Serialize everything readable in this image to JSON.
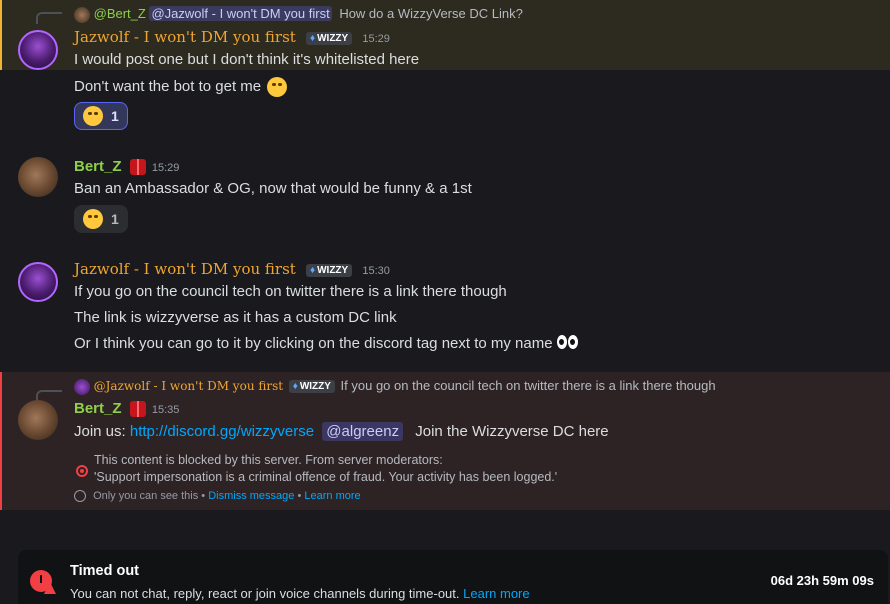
{
  "messages": [
    {
      "reply": {
        "author": "@Bert_Z",
        "mention": "@Jazwolf - I won't DM you first",
        "text": "How do a WizzyVerse DC Link?"
      },
      "author": "Jazwolf - I won't DM you first",
      "tag": "WIZZY",
      "time": "15:29",
      "lines": [
        "I would post one but I don't think it's whitelisted here",
        "Don't want the bot to get me"
      ],
      "reaction": {
        "count": "1"
      }
    },
    {
      "author": "Bert_Z",
      "time": "15:29",
      "lines": [
        "Ban an Ambassador & OG, now that would be funny & a 1st"
      ],
      "reaction": {
        "count": "1"
      }
    },
    {
      "author": "Jazwolf - I won't DM you first",
      "tag": "WIZZY",
      "time": "15:30",
      "lines": [
        "If you go on the council tech on twitter there is a link there though",
        "The link is wizzyverse as it has a custom DC link",
        "Or I think you can go to it by clicking on the discord tag next to my name"
      ]
    },
    {
      "reply": {
        "author": "@Jazwolf - I won't DM you first",
        "tag": "WIZZY",
        "text": "If you go on the council tech on twitter there is a link there though"
      },
      "author": "Bert_Z",
      "time": "15:35",
      "prefix": "Join us:",
      "link": "http://discord.gg/wizzyverse",
      "mention": "@algreenz",
      "suffix": "Join the Wizzyverse DC here",
      "blocked": {
        "line1": "This content is blocked by this server. From server moderators:",
        "line2": "'Support impersonation is a criminal offence of fraud. Your activity has been logged.'",
        "only_you": "Only you can see this •",
        "dismiss": "Dismiss message",
        "sep": "•",
        "learn": "Learn more"
      }
    }
  ],
  "timeout": {
    "title": "Timed out",
    "desc": "You can not chat, reply, react or join voice channels during time-out.",
    "learn": "Learn more",
    "countdown": "06d 23h 59m 09s"
  },
  "colors": {
    "accent": "#5865f2",
    "danger": "#f23f43",
    "link": "#00a8fc",
    "jaz_name": "#f0a530",
    "bert_name": "#8ed04a"
  }
}
